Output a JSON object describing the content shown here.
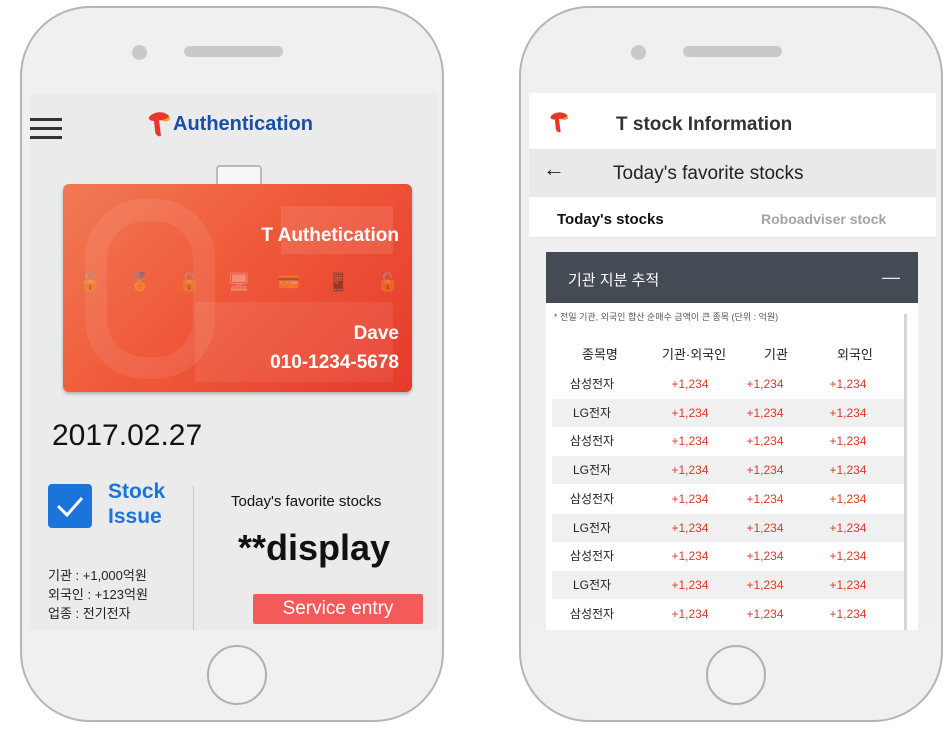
{
  "left": {
    "header_title": "Authentication",
    "card": {
      "title": "T Authetication",
      "name": "Dave",
      "phone": "010-1234-5678",
      "icons": [
        "🔓",
        "🏅",
        "🔓",
        "🖥",
        "💳",
        "📱",
        "🔓"
      ]
    },
    "date": "2017.02.27",
    "issue_label_line1": "Stock",
    "issue_label_line2": "Issue",
    "info_line1": "기관 : +1,000억원",
    "info_line2": "외국인 : +123억원",
    "info_line3": "업종 : 전기전자",
    "favorite_label": "Today's favorite stocks",
    "display_text": "**display",
    "service_button": "Service entry"
  },
  "right": {
    "header_title": "T stock Information",
    "back_icon": "←",
    "sub_title": "Today's favorite stocks",
    "tabs": [
      "Today's stocks",
      "Roboadviser stock"
    ],
    "table_title": "기관 지분 추적",
    "collapse_icon": "—",
    "note": "* 전일 기관, 외국인 합산 순매수 금액이 큰 종목 (단위 : 억원)",
    "columns": [
      "종목명",
      "기관·외국인",
      "기관",
      "외국인"
    ],
    "rows": [
      [
        "삼성전자",
        "+1,234",
        "+1,234",
        "+1,234"
      ],
      [
        "LG전자",
        "+1,234",
        "+1,234",
        "+1,234"
      ],
      [
        "삼성전자",
        "+1,234",
        "+1,234",
        "+1,234"
      ],
      [
        "LG전자",
        "+1,234",
        "+1,234",
        "+1,234"
      ],
      [
        "삼성전자",
        "+1,234",
        "+1,234",
        "+1,234"
      ],
      [
        "LG전자",
        "+1,234",
        "+1,234",
        "+1,234"
      ],
      [
        "삼성전자",
        "+1,234",
        "+1,234",
        "+1,234"
      ],
      [
        "LG전자",
        "+1,234",
        "+1,234",
        "+1,234"
      ],
      [
        "삼성전자",
        "+1,234",
        "+1,234",
        "+1,234"
      ]
    ]
  },
  "colors": {
    "brand_blue": "#1a4ea6",
    "card_red": "#ef5a3a",
    "service_red": "#f35b5b",
    "value_red": "#e0392b",
    "table_header": "#444b54"
  }
}
